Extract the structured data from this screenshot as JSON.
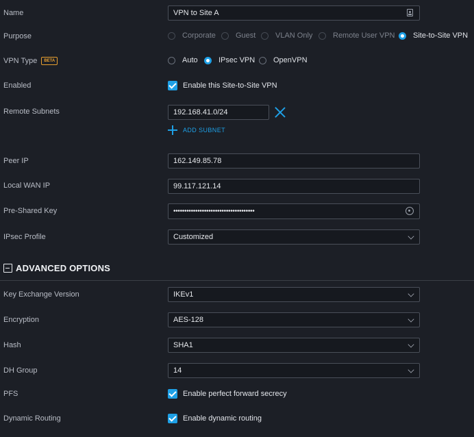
{
  "name": {
    "label": "Name",
    "value": "VPN to Site A"
  },
  "purpose": {
    "label": "Purpose",
    "options": [
      "Corporate",
      "Guest",
      "VLAN Only",
      "Remote User VPN",
      "Site-to-Site VPN"
    ],
    "selected": "Site-to-Site VPN"
  },
  "vpn_type": {
    "label": "VPN Type",
    "badge": "BETA",
    "options": [
      "Auto",
      "IPsec VPN",
      "OpenVPN"
    ],
    "selected": "IPsec VPN"
  },
  "enabled": {
    "label": "Enabled",
    "checkbox_label": "Enable this Site-to-Site VPN",
    "checked": true
  },
  "remote_subnets": {
    "label": "Remote Subnets",
    "value": "192.168.41.0/24",
    "add_label": "ADD SUBNET"
  },
  "peer_ip": {
    "label": "Peer IP",
    "value": "162.149.85.78"
  },
  "local_wan_ip": {
    "label": "Local WAN IP",
    "value": "99.117.121.14"
  },
  "pre_shared_key": {
    "label": "Pre-Shared Key",
    "value": "•••••••••••••••••••••••••••••••••••••"
  },
  "ipsec_profile": {
    "label": "IPsec Profile",
    "value": "Customized"
  },
  "advanced": {
    "title": "ADVANCED OPTIONS"
  },
  "key_exchange": {
    "label": "Key Exchange Version",
    "value": "IKEv1"
  },
  "encryption": {
    "label": "Encryption",
    "value": "AES-128"
  },
  "hash": {
    "label": "Hash",
    "value": "SHA1"
  },
  "dh_group": {
    "label": "DH Group",
    "value": "14"
  },
  "pfs": {
    "label": "PFS",
    "checkbox_label": "Enable perfect forward secrecy",
    "checked": true
  },
  "dynamic_routing": {
    "label": "Dynamic Routing",
    "checkbox_label": "Enable dynamic routing",
    "checked": true
  },
  "colors": {
    "accent": "#1ea0e6",
    "beta": "#e9a030",
    "background": "#1c1f26"
  }
}
